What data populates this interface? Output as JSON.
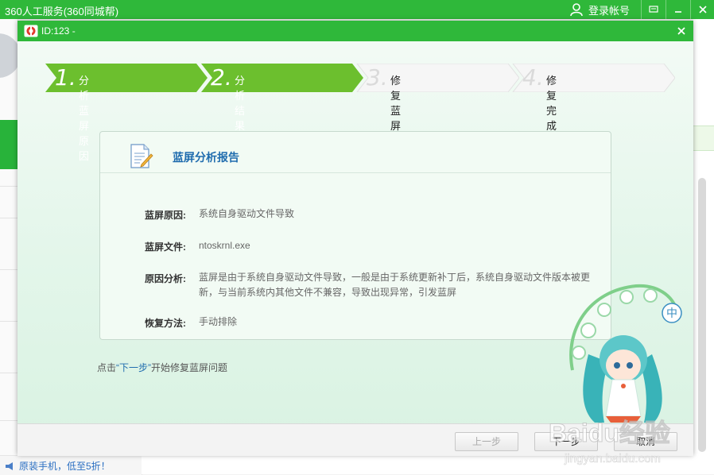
{
  "app": {
    "title": "360人工服务(360同城帮)",
    "login_label": "登录帐号",
    "promo_text": "原装手机，低至5折！"
  },
  "dialog": {
    "title": "ID:123 -",
    "steps": [
      {
        "num": "1.",
        "label": "分析蓝屏原因",
        "state": "active"
      },
      {
        "num": "2.",
        "label": "分析结果",
        "state": "active"
      },
      {
        "num": "3.",
        "label": "修复蓝屏问题",
        "state": "inactive"
      },
      {
        "num": "4.",
        "label": "修复完成",
        "state": "inactive"
      }
    ],
    "report": {
      "title": "蓝屏分析报告",
      "rows": [
        {
          "label": "蓝屏原因:",
          "value": "系统自身驱动文件导致"
        },
        {
          "label": "蓝屏文件:",
          "value": "ntoskrnl.exe"
        },
        {
          "label": "原因分析:",
          "value": "蓝屏是由于系统自身驱动文件导致，一般是由于系统更新补丁后，系统自身驱动文件版本被更新，与当前系统内其他文件不兼容，导致出现异常，引发蓝屏"
        },
        {
          "label": "恢复方法:",
          "value": "手动排除"
        }
      ]
    },
    "hint": {
      "pre": "点击",
      "highlight": "“下一步”",
      "post": "开始修复蓝屏问题"
    },
    "buttons": {
      "prev": "上一步",
      "next": "下一步",
      "cancel": "取消"
    }
  },
  "mascot": {
    "badge": "中"
  },
  "watermark": {
    "brand": "Baidu经验",
    "url": "jingyan.baidu.com"
  },
  "colors": {
    "accent_green": "#2fb83a",
    "step_green": "#6cbf2e",
    "link_blue": "#1f6cae"
  }
}
